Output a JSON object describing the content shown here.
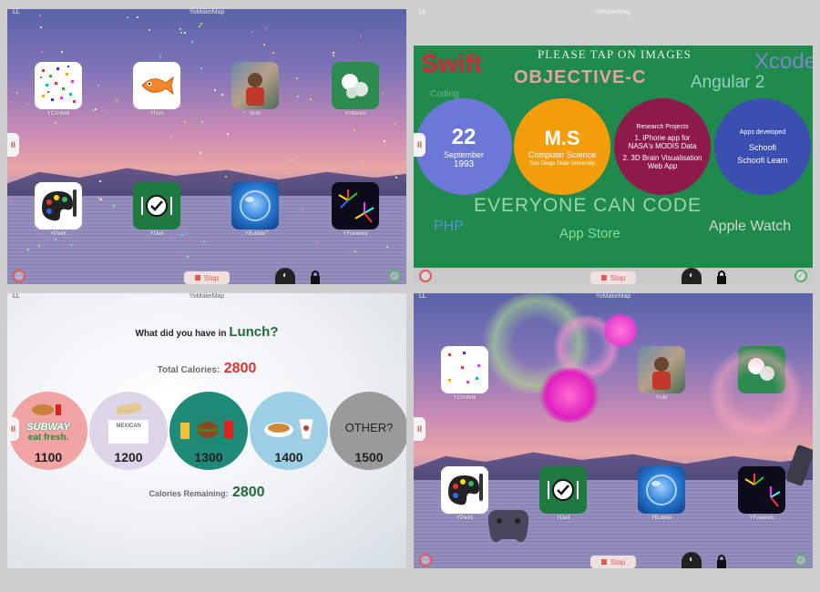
{
  "status": {
    "left": "LL",
    "title": "YoMakeMap"
  },
  "side_tab": {
    "label": "II"
  },
  "bottom": {
    "stop_label": "Stop",
    "moon": "◐"
  },
  "apps": [
    {
      "label": "YConfetti",
      "icon": "confetti-icon"
    },
    {
      "label": "YFish",
      "icon": "fish-icon"
    },
    {
      "label": "Yinfo",
      "icon": "photo-icon"
    },
    {
      "label": "YInterest",
      "icon": "puzzle-icon"
    },
    {
      "label": "YPaint",
      "icon": "paint-palette-icon"
    },
    {
      "label": "YDiet",
      "icon": "diet-plate-icon"
    },
    {
      "label": "YBubble",
      "icon": "bubble-icon"
    },
    {
      "label": "YFirework",
      "icon": "firework-icon"
    }
  ],
  "panel2": {
    "header": "PLEASE TAP ON IMAGES",
    "swift": "Swift",
    "objc": "OBJECTIVE-C",
    "xcode": "Xcode",
    "angular": "Angular 2",
    "coding": "Coding",
    "bubble_date": {
      "day": "22",
      "month": "September",
      "year": "1993"
    },
    "bubble_ms": {
      "title": "M.S",
      "line1": "Computer Science",
      "line2": "San Diego State University"
    },
    "bubble_research": {
      "title": "Research Projects",
      "item1": "1. iPhone app for NASA's MODIS Data",
      "item2": "2. 3D Brain Visualisation Web App"
    },
    "bubble_apps": {
      "title": "Apps developed",
      "item1": "Schoofi",
      "item2": "Schoofi Learn"
    },
    "everyone": "EVERYONE CAN CODE",
    "php": "PHP",
    "appstore": "App Store",
    "applewatch": "Apple Watch"
  },
  "panel3": {
    "question_prefix": "What did you have in ",
    "meal": "Lunch",
    "question_suffix": "?",
    "total_label": "Total Calories:",
    "total_value": "2800",
    "remaining_label": "Calories Remaining:",
    "remaining_value": "2800",
    "foods": [
      {
        "name": "subway-option",
        "brand": "SUBWAY",
        "tagline": "eat fresh.",
        "calories": "1100",
        "color": "#f2a3a3"
      },
      {
        "name": "mexican-option",
        "brand": "MEXICAN",
        "calories": "1200",
        "color": "#ddd6e8"
      },
      {
        "name": "burger-option",
        "calories": "1300",
        "color": "#1f8a78"
      },
      {
        "name": "chinese-option",
        "calories": "1400",
        "color": "#9ccfe6"
      },
      {
        "name": "other-option",
        "brand": "OTHER?",
        "calories": "1500",
        "color": "#9a9a9a"
      }
    ]
  },
  "colors": {
    "accent_red": "#e03030",
    "accent_green": "#1f6a3a",
    "stop_red": "#e05a5a"
  }
}
